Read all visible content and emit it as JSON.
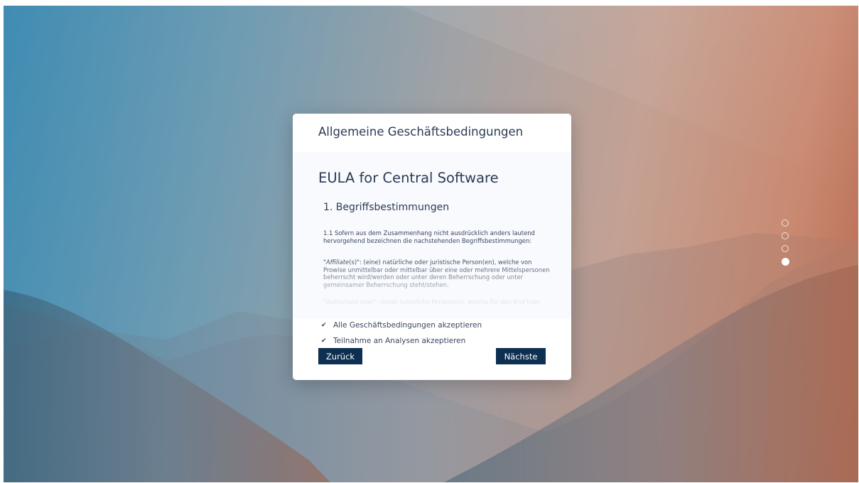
{
  "colors": {
    "primary_button": "#0d2f51",
    "title_text": "#2b3b55",
    "body_text": "#3a4660"
  },
  "dialog": {
    "title": "Allgemeine Geschäftsbedingungen",
    "eula_title": "EULA for Central Software",
    "section_title": "1. Begriffsbestimmungen",
    "paragraph_1": "1.1 Sofern aus dem Zusammenhang nicht ausdrücklich anders lautend hervorgehend bezeichnen die nachstehenden Begriffsbestimmungen:",
    "paragraph_2_term": "Affiliate",
    "paragraph_2_rest": "(s)\": (eine) natürliche oder juristische Person(en), welche von Prowise unmittelbar oder mittelbar über eine oder mehrere Mittelspersonen beherrscht wird/werden oder unter deren Beherrschung oder unter gemeinsamer Beherrschung steht/stehen.",
    "paragraph_3": "\"Authorised User\": (eine) natürliche Person(en), welche für den End User",
    "checkbox_terms": {
      "label": "Alle Geschäftsbedingungen akzeptieren",
      "checked": true,
      "icon": "check-icon"
    },
    "checkbox_analytics": {
      "label": "Teilnahme an Analysen akzeptieren",
      "checked": true,
      "icon": "check-icon"
    },
    "back_button": "Zurück",
    "next_button": "Nächste"
  },
  "pagination": {
    "steps": 4,
    "current_step": 4
  }
}
